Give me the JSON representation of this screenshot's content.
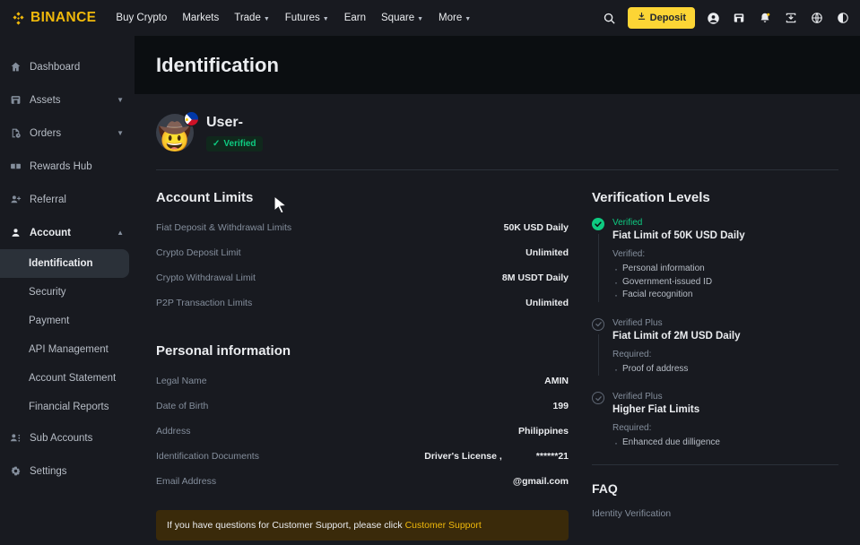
{
  "topnav": {
    "brand": "BINANCE",
    "links": [
      {
        "label": "Buy Crypto",
        "caret": false
      },
      {
        "label": "Markets",
        "caret": false
      },
      {
        "label": "Trade",
        "caret": true
      },
      {
        "label": "Futures",
        "caret": true
      },
      {
        "label": "Earn",
        "caret": false
      },
      {
        "label": "Square",
        "caret": true
      },
      {
        "label": "More",
        "caret": true
      }
    ],
    "deposit_label": "Deposit",
    "icons": [
      "search-icon",
      "profile-icon",
      "wallet-icon",
      "bell-icon",
      "download-box-icon",
      "globe-icon",
      "theme-icon"
    ]
  },
  "sidebar": {
    "items": [
      {
        "label": "Dashboard",
        "icon": "home-icon",
        "expandable": false
      },
      {
        "label": "Assets",
        "icon": "assets-icon",
        "expandable": true
      },
      {
        "label": "Orders",
        "icon": "orders-icon",
        "expandable": true
      },
      {
        "label": "Rewards Hub",
        "icon": "rewards-icon",
        "expandable": false
      },
      {
        "label": "Referral",
        "icon": "referral-icon",
        "expandable": false
      },
      {
        "label": "Account",
        "icon": "account-icon",
        "expandable": true,
        "expanded": true
      }
    ],
    "account_children": [
      {
        "label": "Identification",
        "active": true
      },
      {
        "label": "Security",
        "active": false
      },
      {
        "label": "Payment",
        "active": false
      },
      {
        "label": "API Management",
        "active": false
      },
      {
        "label": "Account Statement",
        "active": false
      },
      {
        "label": "Financial Reports",
        "active": false
      }
    ],
    "footer_items": [
      {
        "label": "Sub Accounts",
        "icon": "sub-accounts-icon"
      },
      {
        "label": "Settings",
        "icon": "gear-icon"
      }
    ]
  },
  "page": {
    "title": "Identification"
  },
  "profile": {
    "username": "User-",
    "verified_label": "Verified",
    "flag": "philippines-flag"
  },
  "account_limits": {
    "title": "Account Limits",
    "rows": [
      {
        "key": "Fiat Deposit & Withdrawal Limits",
        "value": "50K USD Daily"
      },
      {
        "key": "Crypto Deposit Limit",
        "value": "Unlimited"
      },
      {
        "key": "Crypto Withdrawal Limit",
        "value": "8M USDT Daily"
      },
      {
        "key": "P2P Transaction Limits",
        "value": "Unlimited"
      }
    ]
  },
  "personal_information": {
    "title": "Personal information",
    "rows": [
      {
        "key": "Legal Name",
        "value": "AMIN"
      },
      {
        "key": "Date of Birth",
        "value": "199"
      },
      {
        "key": "Address",
        "value": "Philippines"
      },
      {
        "key": "Identification Documents",
        "value": "Driver's License ,",
        "value2": "******21"
      },
      {
        "key": "Email Address",
        "value": "@gmail.com"
      }
    ]
  },
  "notice": {
    "text": "If you have questions for Customer Support, please click ",
    "link": "Customer Support"
  },
  "verification": {
    "title": "Verification Levels",
    "levels": [
      {
        "status": "Verified",
        "state": "done",
        "name": "Fiat Limit of 50K USD Daily",
        "req_label": "Verified:",
        "items": [
          "Personal information",
          "Government-issued ID",
          "Facial recognition"
        ]
      },
      {
        "status": "Verified Plus",
        "state": "todo",
        "name": "Fiat Limit of 2M USD Daily",
        "req_label": "Required:",
        "items": [
          "Proof of address"
        ]
      },
      {
        "status": "Verified Plus",
        "state": "todo",
        "name": "Higher Fiat Limits",
        "req_label": "Required:",
        "items": [
          "Enhanced due dilligence"
        ]
      }
    ]
  },
  "faq": {
    "title": "FAQ",
    "items": [
      "Identity Verification"
    ]
  },
  "colors": {
    "brand_yellow": "#f0b90b",
    "button_yellow": "#fcd535",
    "green": "#0ecb81",
    "bg": "#181a20",
    "banner_bg": "#0b0e11",
    "notice_bg": "#3a2a0a"
  }
}
